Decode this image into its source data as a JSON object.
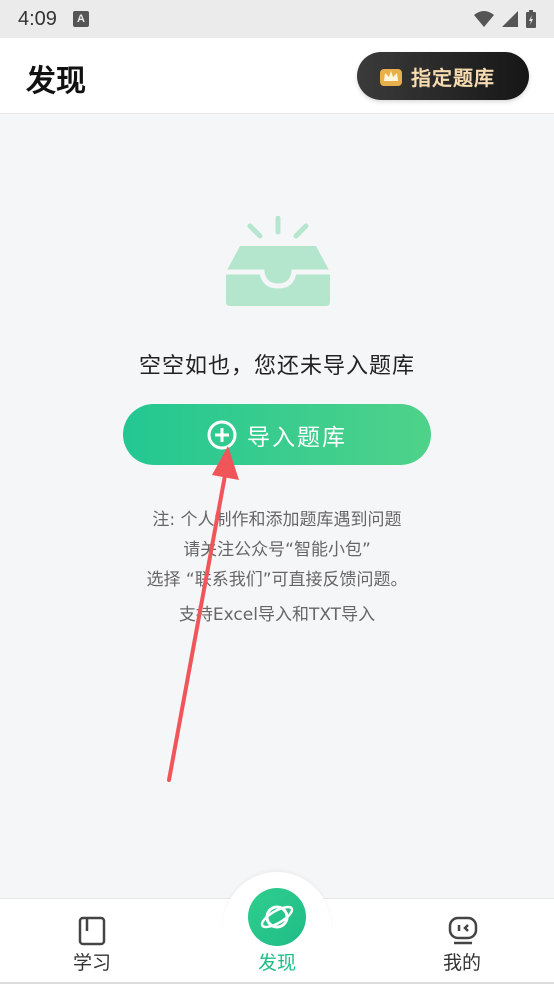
{
  "status_bar": {
    "time": "4:09",
    "notif_letter": "A"
  },
  "header": {
    "title": "发现",
    "vip_label": "指定题库"
  },
  "empty": {
    "message": "空空如也，您还未导入题库",
    "import_label": "导入题库"
  },
  "notes": {
    "line1": "注: 个人制作和添加题库遇到问题",
    "line2": "请关注公众号“智能小包”",
    "line3": "选择 “联系我们”可直接反馈问题。"
  },
  "support": "支持Excel导入和TXT导入",
  "tabs": [
    {
      "label": "学习",
      "icon": "book-icon"
    },
    {
      "label": "发现",
      "icon": "planet-icon"
    },
    {
      "label": "我的",
      "icon": "face-icon"
    }
  ],
  "colors": {
    "accent": "#1fbf86",
    "gold": "#f6dcb0",
    "arrow": "#f0555a"
  }
}
